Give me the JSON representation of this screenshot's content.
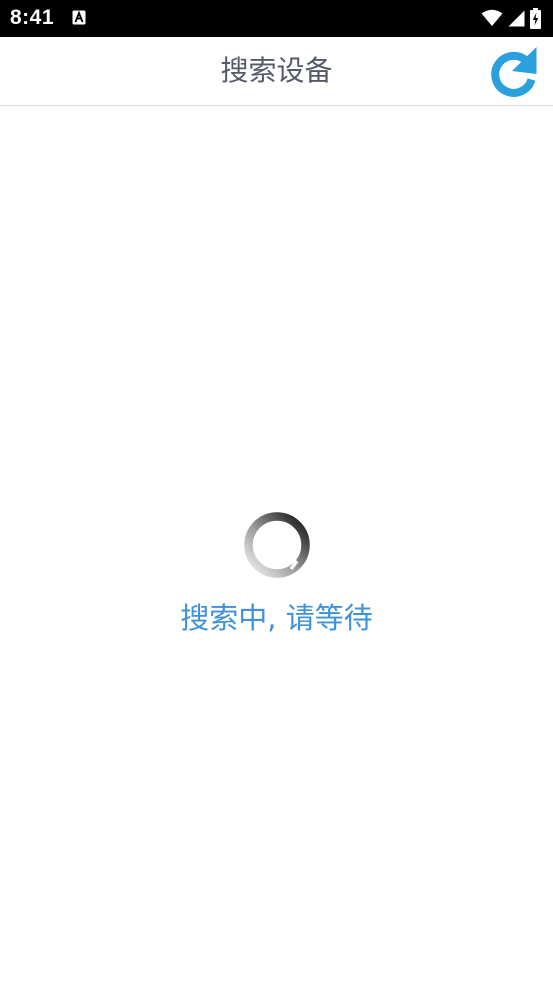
{
  "status_bar": {
    "time": "8:41",
    "notification_icon": "font-a-notification-icon",
    "wifi_icon": "wifi-icon",
    "signal_icon": "cell-signal-icon",
    "battery_icon": "battery-charging-icon"
  },
  "header": {
    "title": "搜索设备",
    "refresh_icon": "refresh-icon",
    "accent_color": "#2aa0dc"
  },
  "main": {
    "spinner_icon": "loading-spinner-icon",
    "loading_text": "搜索中, 请等待",
    "loading_text_color": "#3f92da"
  }
}
